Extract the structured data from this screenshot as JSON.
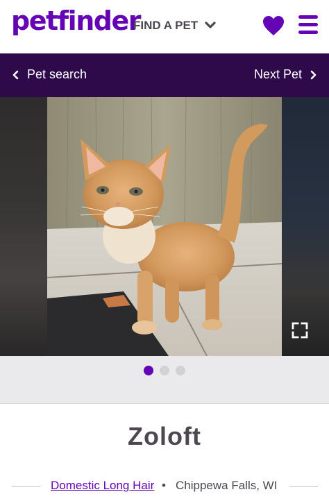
{
  "header": {
    "logo_text": "petfinder",
    "find_pet_label": "FIND A PET"
  },
  "nav": {
    "prev_label": "Pet search",
    "next_label": "Next Pet"
  },
  "carousel": {
    "dots": 3,
    "active_index": 0
  },
  "pet": {
    "name": "Zoloft",
    "breed": "Domestic Long Hair",
    "separator": "•",
    "location": "Chippewa Falls, WI"
  },
  "colors": {
    "brand": "#6504b5",
    "navbar": "#2e0a4b"
  },
  "icons": [
    "chevron-down-icon",
    "heart-icon",
    "menu-icon",
    "chevron-left-icon",
    "chevron-right-icon",
    "expand-icon"
  ]
}
